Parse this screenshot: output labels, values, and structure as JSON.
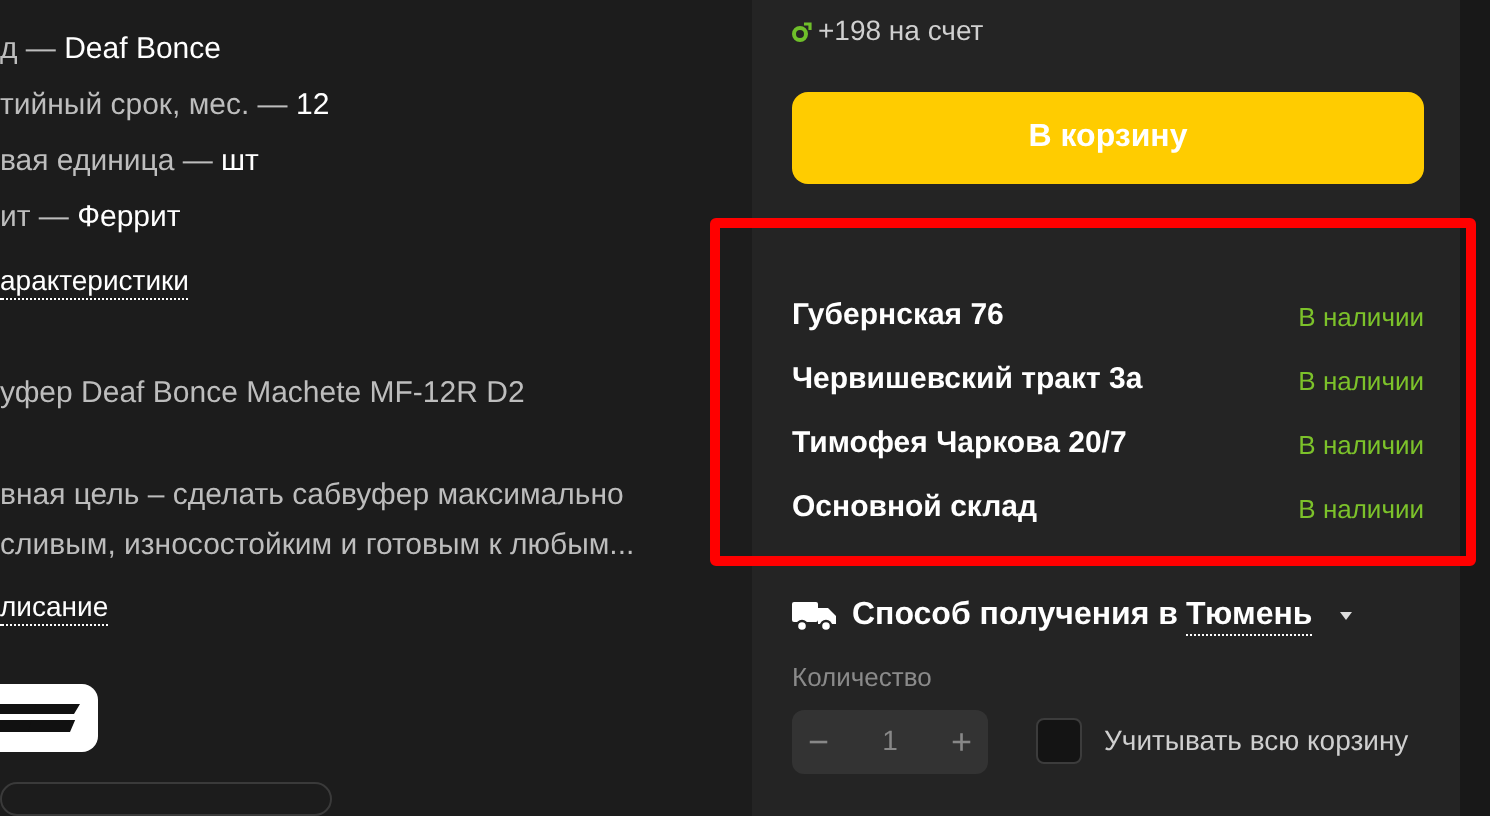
{
  "specs": [
    {
      "label": "д —",
      "value": "Deaf Bonce"
    },
    {
      "label": "тийный срок, мес. —",
      "value": "12"
    },
    {
      "label": "вая единица —",
      "value": "шт"
    },
    {
      "label": "ит —",
      "value": "Феррит"
    }
  ],
  "specs_link": "арактеристики",
  "product_title": "уфер Deaf Bonce Machete MF-12R D2",
  "description": "вная цель – сделать сабвуфер максимально сливым, износостойким и готовым к любым...",
  "description_link": "лисание",
  "bonus": "+198 на счет",
  "cart_button": "В корзину",
  "stores": {
    "highlighted": true,
    "items": [
      {
        "name": "Губернская 76",
        "status": "В наличии",
        "in_stock": true
      },
      {
        "name": "Червишевский тракт 3а",
        "status": "В наличии",
        "in_stock": true
      },
      {
        "name": "Тимофея Чаркова 20/7",
        "status": "В наличии",
        "in_stock": true
      },
      {
        "name": "Основной склад",
        "status": "В наличии",
        "in_stock": true
      }
    ]
  },
  "delivery": {
    "label": "Способ получения в",
    "city": "Тюмень"
  },
  "quantity": {
    "label": "Количество",
    "minus": "−",
    "value": "1",
    "plus": "+"
  },
  "whole_cart": {
    "label": "Учитывать всю корзину",
    "checked": false
  }
}
